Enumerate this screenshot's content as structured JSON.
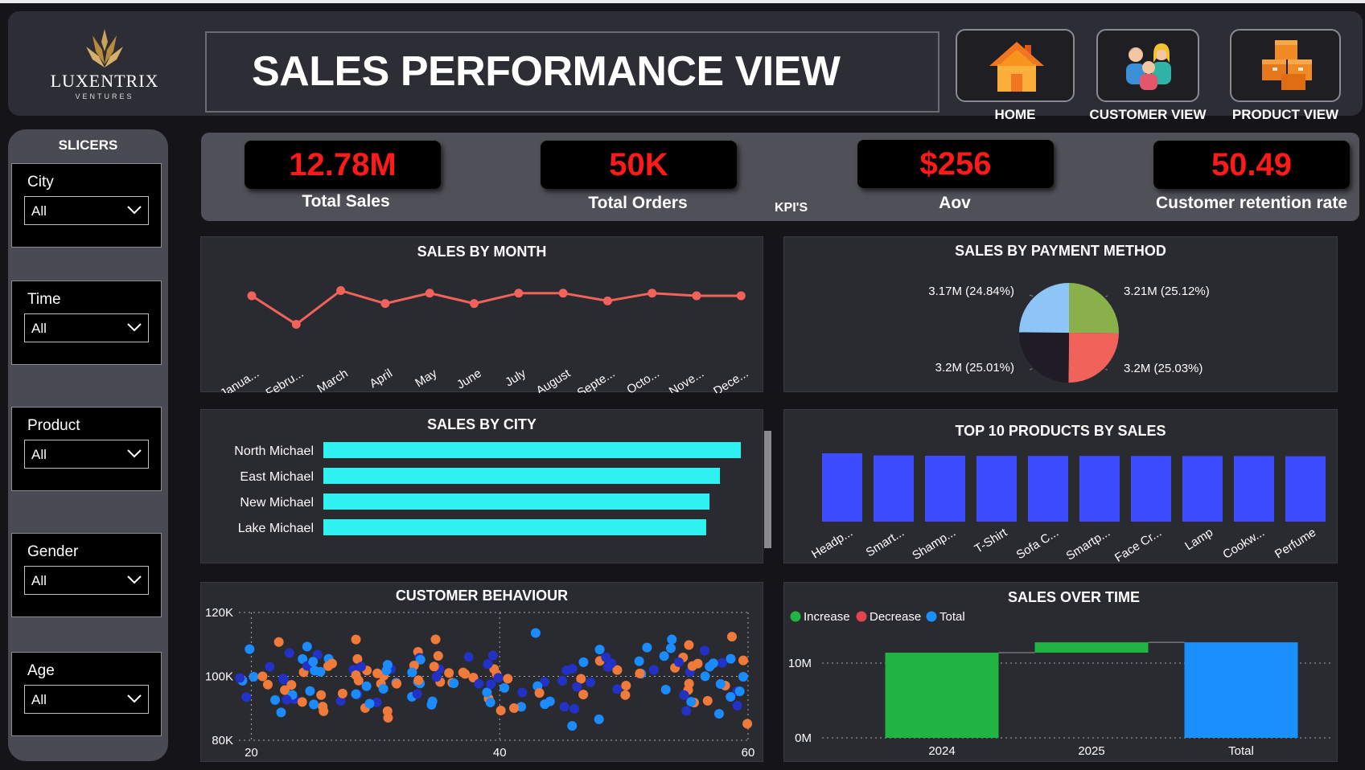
{
  "header": {
    "brand": "LUXENTRIX",
    "brand_sub": "VENTURES",
    "title": "SALES PERFORMANCE VIEW",
    "nav": [
      {
        "label": "HOME",
        "icon": "house-icon"
      },
      {
        "label": "CUSTOMER VIEW",
        "icon": "people-icon"
      },
      {
        "label": "PRODUCT VIEW",
        "icon": "boxes-icon"
      }
    ]
  },
  "slicers": {
    "title": "SLICERS",
    "items": [
      {
        "label": "City",
        "value": "All"
      },
      {
        "label": "Time",
        "value": "All"
      },
      {
        "label": "Product",
        "value": "All"
      },
      {
        "label": "Gender",
        "value": "All"
      },
      {
        "label": "Age",
        "value": "All"
      }
    ]
  },
  "kpis": {
    "tag": "KPI'S",
    "items": [
      {
        "value": "12.78M",
        "label": "Total Sales"
      },
      {
        "value": "50K",
        "label": "Total Orders"
      },
      {
        "value": "$256",
        "label": "Aov"
      },
      {
        "value": "50.49",
        "label": "Customer retention rate"
      }
    ]
  },
  "colors": {
    "kpi_value": "#ff1a1a",
    "line": "#f0625a",
    "city_bar": "#2ef2f2",
    "product_bar": "#3d4bff",
    "increase": "#20b443",
    "decrease": "#e5434d",
    "total": "#1a90ff"
  },
  "chart_data": [
    {
      "type": "line",
      "title": "SALES BY MONTH",
      "categories": [
        "Janua...",
        "Febru...",
        "March",
        "April",
        "May",
        "June",
        "July",
        "August",
        "Septe...",
        "Octo...",
        "Nove...",
        "Dece..."
      ],
      "values": [
        1.09,
        0.98,
        1.11,
        1.06,
        1.1,
        1.06,
        1.1,
        1.1,
        1.07,
        1.1,
        1.09,
        1.09
      ]
    },
    {
      "type": "pie",
      "title": "SALES BY PAYMENT METHOD",
      "slices": [
        {
          "label": "3.21M (25.12%)",
          "value": 25.12,
          "color": "#8ab04b"
        },
        {
          "label": "3.2M (25.03%)",
          "value": 25.03,
          "color": "#f0625a"
        },
        {
          "label": "3.2M (25.01%)",
          "value": 25.01,
          "color": "#1f1c26"
        },
        {
          "label": "3.17M (24.84%)",
          "value": 24.84,
          "color": "#8ec5f7"
        }
      ]
    },
    {
      "type": "bar",
      "title": "SALES BY CITY",
      "orientation": "horizontal",
      "categories": [
        "North Michael",
        "East Michael",
        "New Michael",
        "Lake Michael"
      ],
      "values": [
        100,
        95,
        92.5,
        91.7
      ]
    },
    {
      "type": "bar",
      "title": "TOP 10 PRODUCTS BY SALES",
      "categories": [
        "Headp...",
        "Smart...",
        "Shamp...",
        "T-Shirt",
        "Sofa C...",
        "Smartp...",
        "Face Cr...",
        "Lamp",
        "Cookw...",
        "Perfume"
      ],
      "values": [
        100,
        97,
        96.5,
        96.3,
        96.2,
        96.2,
        96.1,
        96.0,
        96.0,
        95.7
      ]
    },
    {
      "type": "scatter",
      "title": "CUSTOMER BEHAVIOUR",
      "xticks": [
        "20",
        "40",
        "60"
      ],
      "yticks": [
        "120K",
        "100K",
        "80K"
      ],
      "xlim": [
        19,
        60
      ],
      "ylim": [
        80000,
        120000
      ],
      "grid": true
    },
    {
      "type": "bar",
      "subtype": "waterfall",
      "title": "SALES OVER TIME",
      "legend": [
        "Increase",
        "Decrease",
        "Total"
      ],
      "categories": [
        "2024",
        "2025",
        "Total"
      ],
      "values": [
        11.4,
        1.38,
        12.78
      ],
      "kinds": [
        "increase",
        "increase",
        "total"
      ],
      "yticks": [
        "10M",
        "0M"
      ],
      "ylim": [
        0,
        14
      ]
    }
  ]
}
